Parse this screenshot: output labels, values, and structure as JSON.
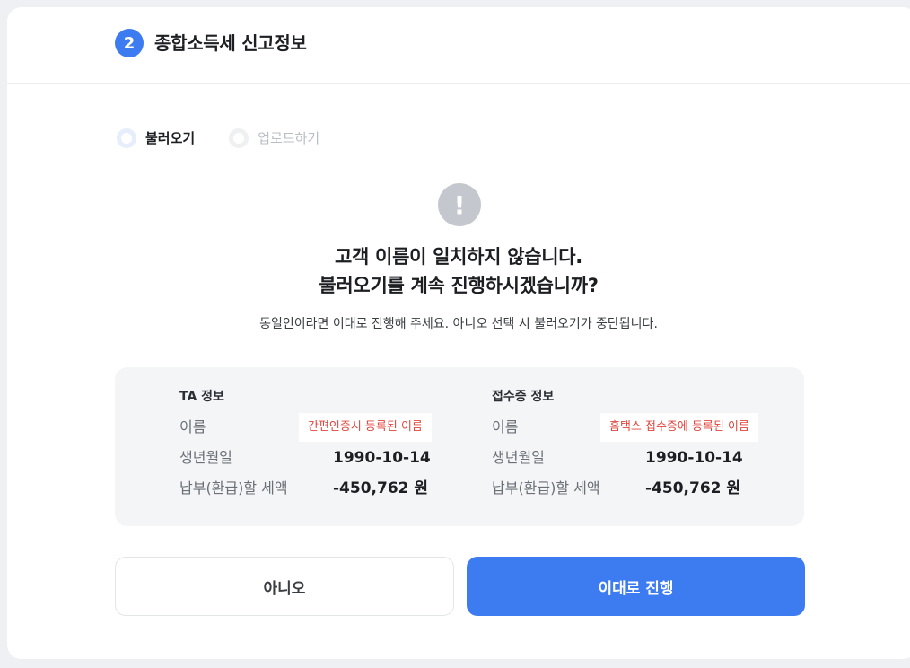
{
  "header": {
    "step_number": "2",
    "title": "종합소득세 신고정보"
  },
  "source_options": [
    {
      "label": "불러오기",
      "selected": true
    },
    {
      "label": "업로드하기",
      "selected": false
    }
  ],
  "alert": {
    "icon": "exclamation-icon",
    "icon_glyph": "!",
    "title_line1": "고객 이름이 일치하지 않습니다.",
    "title_line2": "불러오기를 계속 진행하시겠습니까?",
    "subtitle": "동일인이라면 이대로 진행해 주세요. 아니오 선택 시 불러오기가 중단됩니다."
  },
  "comparison": {
    "ta": {
      "title": "TA 정보",
      "name_label": "이름",
      "name_value": "간편인증시 등록된 이름",
      "birth_label": "생년월일",
      "birth_value": "1990-10-14",
      "tax_label": "납부(환급)할 세액",
      "tax_value": "-450,762 원"
    },
    "receipt": {
      "title": "접수증 정보",
      "name_label": "이름",
      "name_value": "홈택스 접수증에 등록된 이름",
      "birth_label": "생년월일",
      "birth_value": "1990-10-14",
      "tax_label": "납부(환급)할 세액",
      "tax_value": "-450,762 원"
    }
  },
  "buttons": {
    "no_label": "아니오",
    "yes_label": "이대로 진행"
  },
  "colors": {
    "accent": "#3d7cf0",
    "warning_text": "#e0463e",
    "alert_icon_bg": "#c4c8ce"
  }
}
